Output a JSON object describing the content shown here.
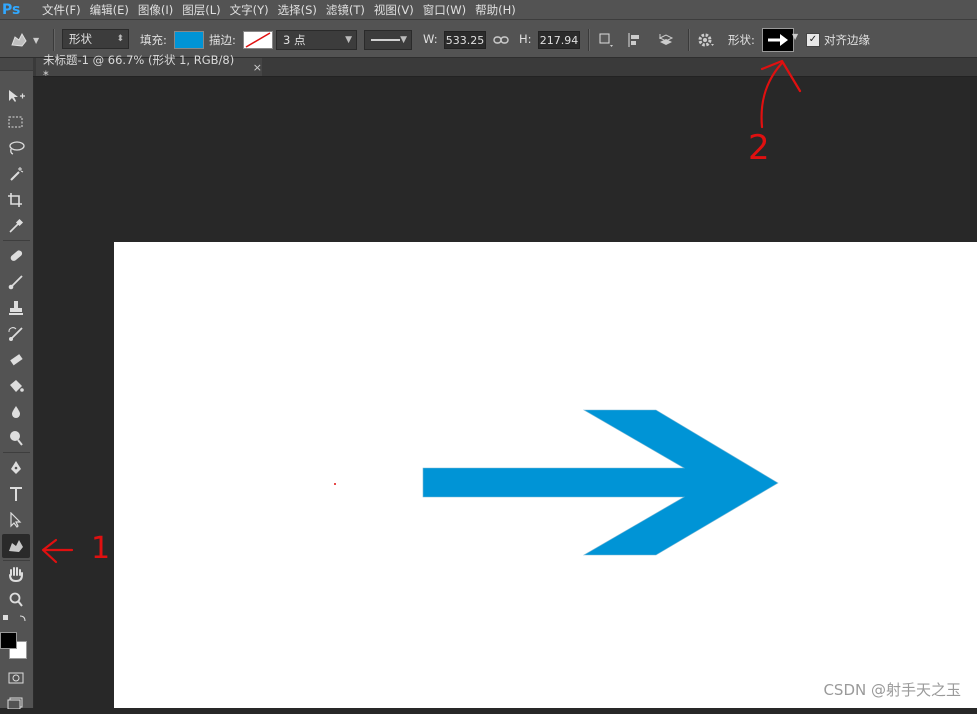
{
  "app": {
    "logo": "Ps"
  },
  "menu": [
    "文件(F)",
    "编辑(E)",
    "图像(I)",
    "图层(L)",
    "文字(Y)",
    "选择(S)",
    "滤镜(T)",
    "视图(V)",
    "窗口(W)",
    "帮助(H)"
  ],
  "options": {
    "mode_value": "形状",
    "fill_label": "填充:",
    "fill_color": "#0094d6",
    "stroke_label": "描边:",
    "stroke_width_value": "3 点",
    "w_label": "W:",
    "w_value": "533.25",
    "h_label": "H:",
    "h_value": "217.94",
    "shape_label": "形状:",
    "align_edges_label": "对齐边缘",
    "align_edges_checked": true
  },
  "document": {
    "tab_title": "未标题-1 @ 66.7% (形状 1, RGB/8) *",
    "close_glyph": "×"
  },
  "annotations": {
    "marker_1": "1",
    "marker_2": "2"
  },
  "watermark": "CSDN @射手天之玉",
  "colors": {
    "shape_fill": "#0094d6",
    "annotation_red": "#e01010"
  }
}
